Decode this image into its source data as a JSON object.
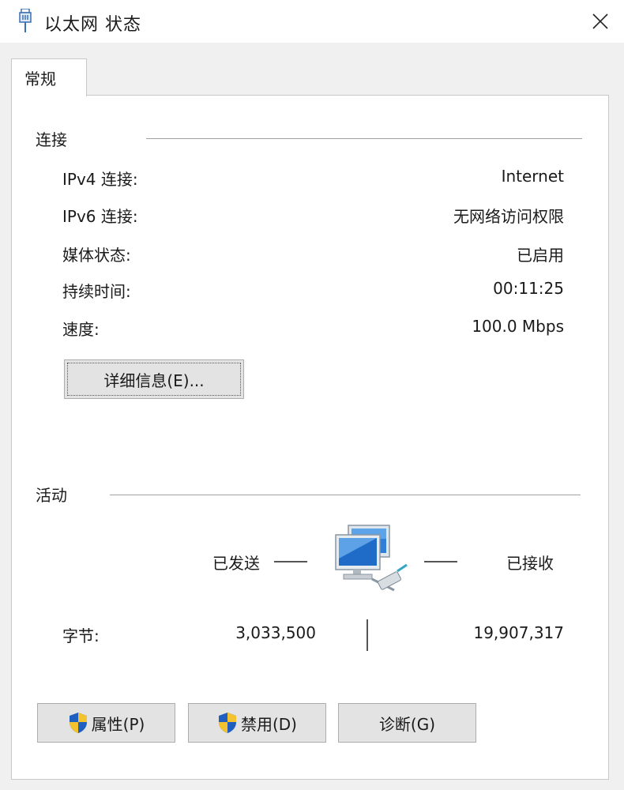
{
  "window": {
    "title": "以太网 状态",
    "icon": "network-adapter-icon",
    "close": "close-icon"
  },
  "tabs": [
    {
      "label": "常规",
      "active": true
    }
  ],
  "connection": {
    "section_title": "连接",
    "rows": [
      {
        "label": "IPv4 连接:",
        "value": "Internet"
      },
      {
        "label": "IPv6 连接:",
        "value": "无网络访问权限"
      },
      {
        "label": "媒体状态:",
        "value": "已启用"
      },
      {
        "label": "持续时间:",
        "value": "00:11:25"
      },
      {
        "label": "速度:",
        "value": "100.0 Mbps"
      }
    ],
    "details_button": "详细信息(E)..."
  },
  "activity": {
    "section_title": "活动",
    "sent_label": "已发送",
    "received_label": "已接收",
    "icon": "network-computers-icon",
    "bytes_label": "字节:",
    "bytes_sent": "3,033,500",
    "bytes_received": "19,907,317"
  },
  "buttons": {
    "properties": "属性(P)",
    "disable": "禁用(D)",
    "diagnose": "诊断(G)"
  },
  "colors": {
    "window_bg": "#f0f0f0",
    "panel_bg": "#ffffff",
    "button_bg": "#e3e3e3",
    "shield_blue": "#1f5fbf",
    "shield_yellow": "#f2c230"
  }
}
